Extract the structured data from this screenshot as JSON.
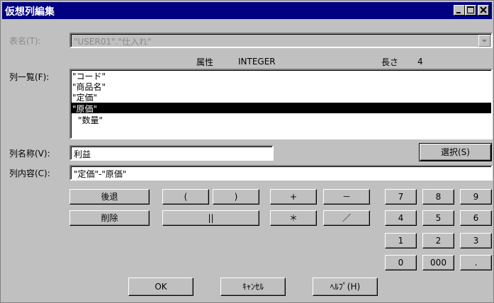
{
  "window": {
    "title": "仮想列編集"
  },
  "table_field": {
    "label": "表名(T):",
    "value": "\"USER01\".\"仕入れ\""
  },
  "attribute": {
    "label": "属性",
    "value": "INTEGER",
    "length_label": "長さ",
    "length_value": "4"
  },
  "column_list": {
    "label": "列一覧(F):",
    "items": [
      "\"コード\"",
      "\"商品名\"",
      "\"定価\"",
      "\"原価\"",
      "\"数量\""
    ],
    "selected_index": 3
  },
  "column_name": {
    "label": "列名称(V):",
    "value": "利益"
  },
  "select_button": {
    "label": "選択(S)"
  },
  "column_content": {
    "label": "列内容(C):",
    "value": "\"定価\"-\"原価\""
  },
  "edit_buttons": {
    "back": "後退",
    "delete": "削除"
  },
  "operator_buttons": {
    "lparen": "(",
    "rparen": ")",
    "plus": "+",
    "minus": "－",
    "concat": "||",
    "multiply": "＊",
    "divide": "／"
  },
  "keypad": [
    "7",
    "8",
    "9",
    "4",
    "5",
    "6",
    "1",
    "2",
    "3",
    "0",
    "000",
    "."
  ],
  "dialog_buttons": {
    "ok": "OK",
    "cancel": "ｷｬﾝｾﾙ",
    "help": "ﾍﾙﾌﾟ(H)"
  }
}
